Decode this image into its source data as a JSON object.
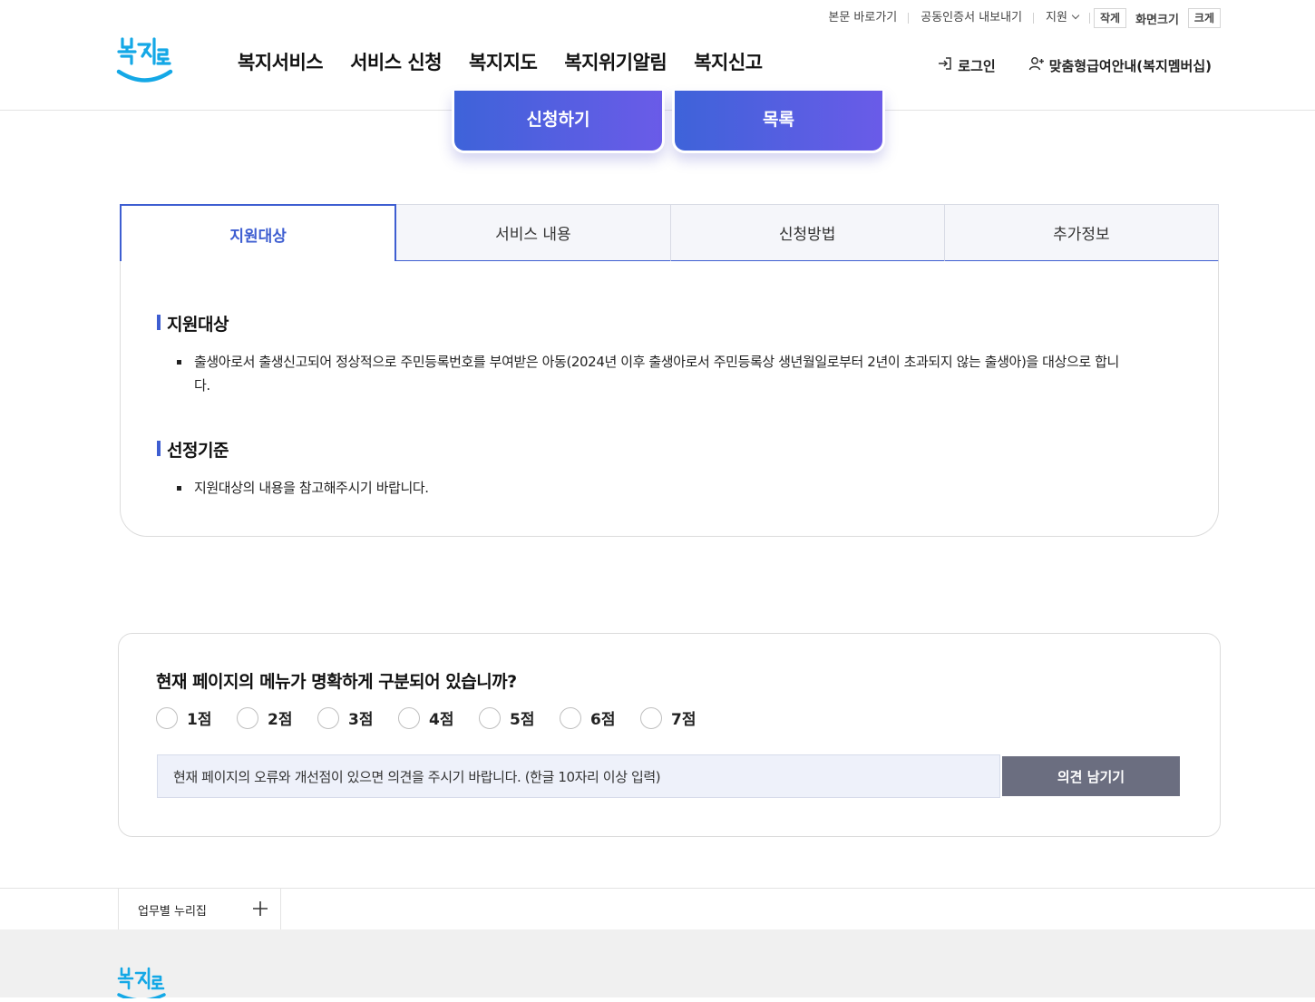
{
  "utility": {
    "skip_link": "본문 바로가기",
    "cert_export": "공동인증서 내보내기",
    "support": "지원",
    "size_small": "작게",
    "size_label": "화면크기",
    "size_large": "크게"
  },
  "header": {
    "logo_text": "복지로",
    "nav": [
      "복지서비스",
      "서비스 신청",
      "복지지도",
      "복지위기알림",
      "복지신고"
    ],
    "login": "로그인",
    "membership": "맞춤형급여안내(복지멤버십)"
  },
  "actions": {
    "apply": "신청하기",
    "list": "목록"
  },
  "tabs": [
    {
      "label": "지원대상",
      "active": true
    },
    {
      "label": "서비스 내용",
      "active": false
    },
    {
      "label": "신청방법",
      "active": false
    },
    {
      "label": "추가정보",
      "active": false
    }
  ],
  "content": {
    "section1_title": "지원대상",
    "section1_line1": "출생아로서 출생신고되어 정상적으로 주민등록번호를 부여받은 아동(2024년 이후 출생아로서 주민등록상 생년월일로부터 2년이 초과되지 않는 출생아)을 대상으로 합니",
    "section1_line2": "다.",
    "section2_title": "선정기준",
    "section2_bullet": "지원대상의 내용을 참고해주시기 바랍니다."
  },
  "survey": {
    "question": "현재 페이지의 메뉴가 명확하게 구분되어 있습니까?",
    "options": [
      "1점",
      "2점",
      "3점",
      "4점",
      "5점",
      "6점",
      "7점"
    ],
    "input_placeholder": "현재 페이지의 오류와 개선점이 있으면 의견을 주시기 바랍니다. (한글 10자리 이상 입력)",
    "submit": "의견 남기기"
  },
  "footer": {
    "glossary": "업무별 누리집"
  },
  "colors": {
    "accent": "#3e5ed1",
    "button_gradient_start": "#3e63d9",
    "button_gradient_end": "#6a5be8",
    "submit_bg": "#6b6e80",
    "logo_blue": "#14a8e6"
  }
}
